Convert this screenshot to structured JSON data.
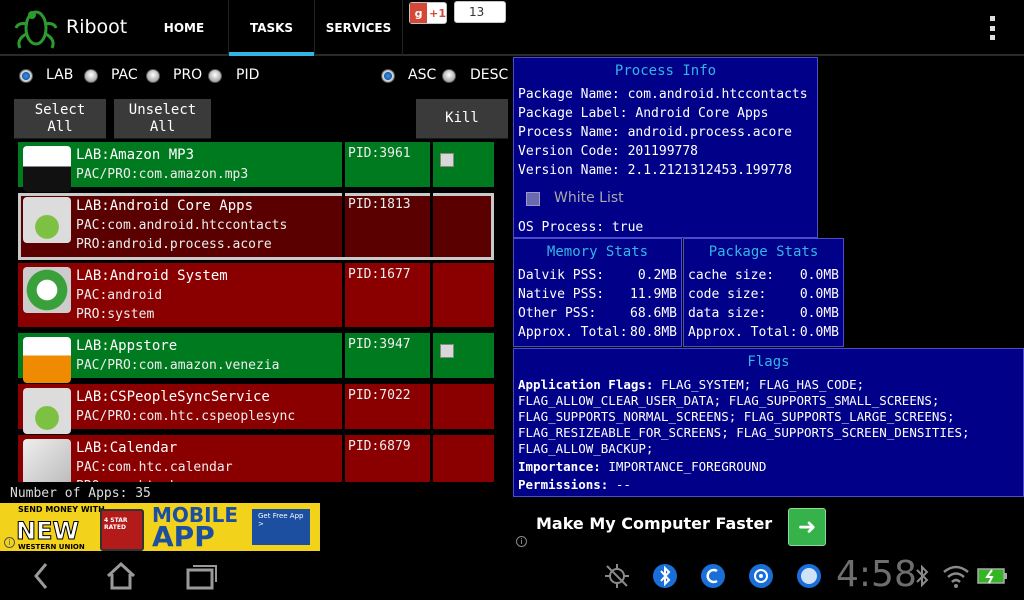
{
  "app": {
    "title": "Riboot",
    "tabs": [
      "HOME",
      "TASKS",
      "SERVICES"
    ],
    "active_tab": "TASKS"
  },
  "gplus": {
    "label": "+1",
    "count": "13"
  },
  "sort": {
    "fields": [
      "LAB",
      "PAC",
      "PRO",
      "PID"
    ],
    "selected_field": "LAB",
    "orders": [
      "ASC",
      "DESC"
    ],
    "selected_order": "ASC"
  },
  "buttons": {
    "select_all": "Select\nAll",
    "unselect_all": "Unselect\nAll",
    "kill": "Kill"
  },
  "apps": [
    {
      "lab": "LAB:Amazon MP3",
      "lines": [
        "PAC/PRO:com.amazon.mp3"
      ],
      "pid": "PID:3961",
      "color": "green",
      "checkbox": true,
      "icon": "amazon-mp3-icon"
    },
    {
      "lab": "LAB:Android Core Apps",
      "lines": [
        "PAC:com.android.htccontacts",
        "PRO:android.process.acore"
      ],
      "pid": "PID:1813",
      "color": "red",
      "selected": true,
      "icon": "android-icon"
    },
    {
      "lab": "LAB:Android System",
      "lines": [
        "PAC:android",
        "PRO:system"
      ],
      "pid": "PID:1677",
      "color": "red",
      "icon": "android-system-icon"
    },
    {
      "lab": "LAB:Appstore",
      "lines": [
        "PAC/PRO:com.amazon.venezia"
      ],
      "pid": "PID:3947",
      "color": "green",
      "checkbox": true,
      "icon": "amazon-apps-icon"
    },
    {
      "lab": "LAB:CSPeopleSyncService",
      "lines": [
        "PAC/PRO:com.htc.cspeoplesync"
      ],
      "pid": "PID:7022",
      "color": "red",
      "icon": "android-icon"
    },
    {
      "lab": "LAB:Calendar",
      "lines": [
        "PAC:com.htc.calendar",
        "PRO:com.htc.bgp"
      ],
      "pid": "PID:6879",
      "color": "red",
      "icon": "play-store-icon"
    }
  ],
  "app_count": "Number of Apps: 35",
  "process_info": {
    "title": "Process Info",
    "lines": [
      "Package Name: com.android.htccontacts",
      "Package Label: Android Core Apps",
      "Process Name: android.process.acore",
      "Version Code: 201199778",
      "Version Name: 2.1.2121312453.199778"
    ],
    "white_list": "White List",
    "os_process": "OS Process: true"
  },
  "memory_stats": {
    "title": "Memory Stats",
    "rows": [
      {
        "label": "Dalvik PSS:",
        "value": "0.2MB"
      },
      {
        "label": "Native PSS:",
        "value": "11.9MB"
      },
      {
        "label": "Other PSS:",
        "value": "68.6MB"
      },
      {
        "label": "Approx. Total:",
        "value": "80.8MB"
      }
    ]
  },
  "package_stats": {
    "title": "Package Stats",
    "rows": [
      {
        "label": "cache size:",
        "value": "0.0MB"
      },
      {
        "label": "code size:",
        "value": "0.0MB"
      },
      {
        "label": "data size:",
        "value": "0.0MB"
      },
      {
        "label": "Approx. Total:",
        "value": "0.0MB"
      }
    ]
  },
  "flags": {
    "title": "Flags",
    "app_flags_label": "Application Flags:",
    "app_flags_lines": [
      " FLAG_SYSTEM; FLAG_HAS_CODE;",
      "FLAG_ALLOW_CLEAR_USER_DATA; FLAG_SUPPORTS_SMALL_SCREENS;",
      "FLAG_SUPPORTS_NORMAL_SCREENS; FLAG_SUPPORTS_LARGE_SCREENS;",
      "FLAG_RESIZEABLE_FOR_SCREENS; FLAG_SUPPORTS_SCREEN_DENSITIES;",
      "FLAG_ALLOW_BACKUP;"
    ],
    "importance_label": "Importance:",
    "importance_value": " IMPORTANCE_FOREGROUND",
    "permissions_label": "Permissions:",
    "permissions_value": " --"
  },
  "ad_left": {
    "line1": "SEND MONEY WITH",
    "new": "NEW",
    "brand": "WESTERN UNION",
    "rated": "4 STAR RATED",
    "mobile": "MOBILE",
    "app": "APP",
    "cta": "Get Free App >"
  },
  "ad_right": {
    "text": "Make My Computer Faster"
  },
  "status": {
    "time": "4:58"
  }
}
